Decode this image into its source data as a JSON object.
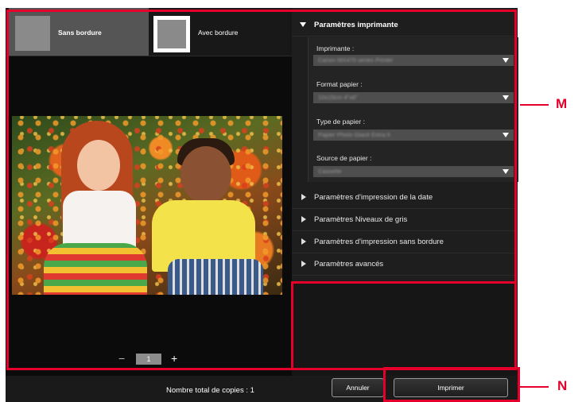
{
  "tabs": {
    "borderless_label": "Sans bordure",
    "bordered_label": "Avec bordure"
  },
  "preview": {
    "copies_value": "1",
    "minus_symbol": "−",
    "plus_symbol": "+"
  },
  "printer_settings": {
    "header": "Paramètres imprimante",
    "printer_label": "Imprimante :",
    "printer_value": "Canon MX470 series Printer",
    "paper_size_label": "Format papier :",
    "paper_size_value": "10x15cm 4\"x6\"",
    "media_type_label": "Type de papier :",
    "media_type_value": "Papier Photo Glacé Extra II",
    "paper_source_label": "Source de papier :",
    "paper_source_value": "Cassette"
  },
  "collapsed_sections": [
    "Paramètres d'impression de la date",
    "Paramètres Niveaux de gris",
    "Paramètres d'impression sans bordure",
    "Paramètres avancés"
  ],
  "bottom_bar": {
    "total_copies": "Nombre total de copies : 1",
    "cancel_label": "Annuler",
    "print_label": "Imprimer"
  },
  "callouts": {
    "m_label": "M",
    "n_label": "N"
  },
  "colors": {
    "annotation_red": "#e4002b",
    "panel_dark": "#141414"
  }
}
